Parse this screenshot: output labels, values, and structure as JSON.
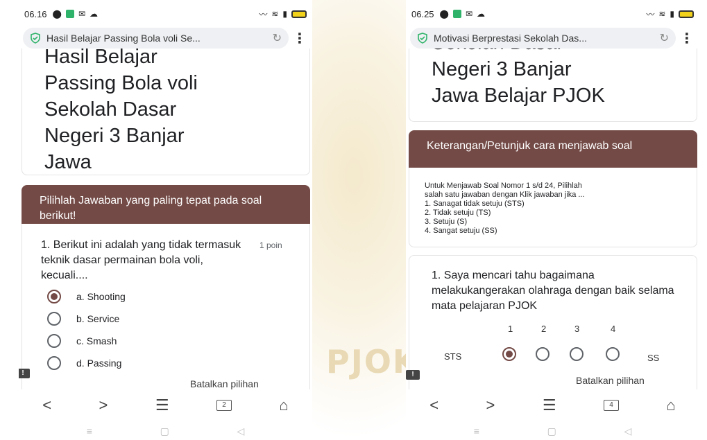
{
  "left_phone": {
    "status": {
      "time": "06.16"
    },
    "tab_title": "Hasil Belajar Passing Bola voli Se...",
    "form_title_lines": [
      "Hasil Belajar",
      "Passing Bola voli",
      "Sekolah Dasar",
      "Negeri 3 Banjar",
      "Jawa"
    ],
    "section_header": "Pilihlah Jawaban yang paling tepat pada soal berikut!",
    "question": "1. Berikut ini adalah yang tidak termasuk teknik dasar permainan bola voli, kecuali....",
    "points": "1 poin",
    "options": [
      "a. Shooting",
      "b. Service",
      "c. Smash",
      "d. Passing"
    ],
    "selected_index": 0,
    "clear_label": "Batalkan pilihan",
    "tab_count": "2"
  },
  "right_phone": {
    "status": {
      "time": "06.25"
    },
    "tab_title": "Motivasi Berprestasi Sekolah Das...",
    "form_title_lines": [
      "Sekolah Dasar",
      "Negeri 3 Banjar",
      "Jawa Belajar PJOK"
    ],
    "section_header": "Keterangan/Petunjuk cara menjawab soal",
    "instructions": [
      "Untuk Menjawab Soal Nomor 1 s/d 24, Pilihlah",
      "salah satu jawaban dengan Klik jawaban jika ...",
      "1. Sanagat tidak setuju (STS)",
      "2. Tidak setuju (TS)",
      "3. Setuju (S)",
      "4. Sangat setuju (SS)"
    ],
    "question": "1. Saya mencari tahu bagaimana melakukangerakan olahraga dengan baik selama mata pelajaran PJOK",
    "scale": {
      "labels": [
        "1",
        "2",
        "3",
        "4"
      ],
      "low": "STS",
      "high": "SS",
      "selected_index": 0
    },
    "clear_label": "Batalkan pilihan",
    "tab_count": "4"
  },
  "watermark_text": "PJOK",
  "colors": {
    "accent": "#734a46"
  }
}
